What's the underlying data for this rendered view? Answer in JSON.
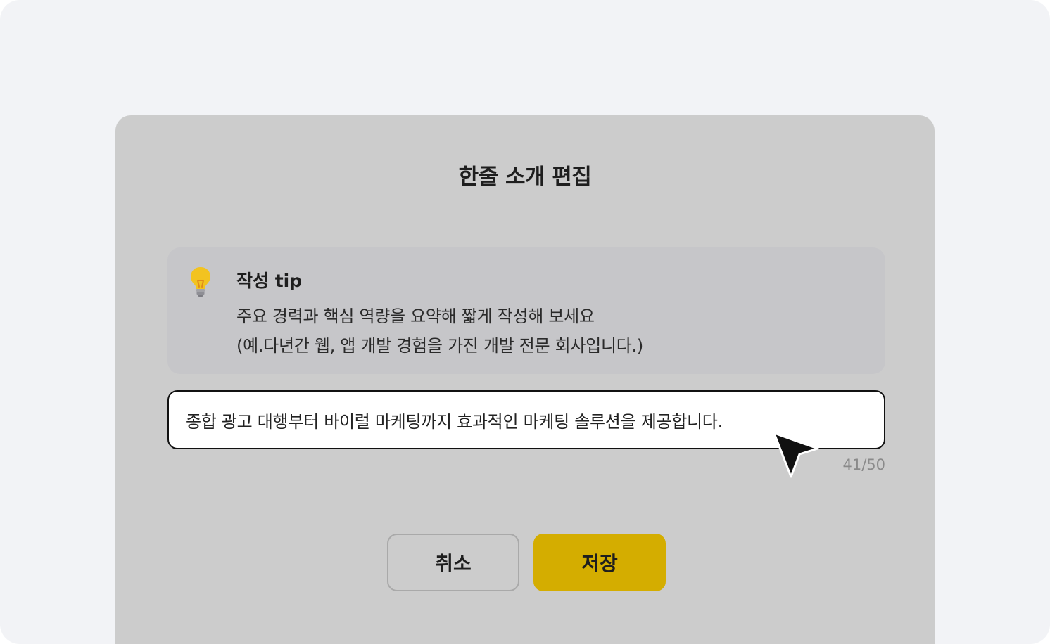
{
  "modal": {
    "title": "한줄 소개 편집"
  },
  "tip": {
    "icon": "lightbulb-icon",
    "title": "작성 tip",
    "line1": "주요 경력과 핵심 역량을 요약해 짧게 작성해 보세요",
    "line2": "(예.다년간 웹, 앱 개발 경험을 가진 개발 전문 회사입니다.)"
  },
  "intro_input": {
    "value": "종합 광고 대행부터 바이럴 마케팅까지 효과적인 마케팅 솔루션을 제공합니다.",
    "char_count": "41/50"
  },
  "buttons": {
    "cancel_label": "취소",
    "save_label": "저장"
  },
  "colors": {
    "accent": "#d4ad00",
    "modal_bg": "#cccccc",
    "tip_bg": "#c6c6c9",
    "page_bg": "#f2f3f6"
  }
}
